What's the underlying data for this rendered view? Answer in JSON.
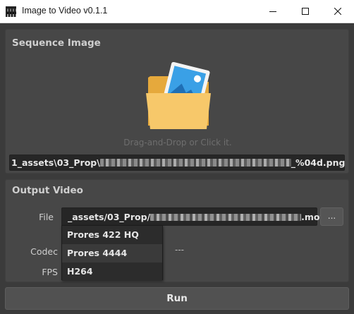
{
  "window": {
    "title": "Image to Video v0.1.1",
    "controls": [
      "minimize-icon",
      "maximize-icon",
      "close-icon"
    ]
  },
  "sequence_image": {
    "title": "Sequence Image",
    "drop_hint": "Drag-and-Drop or Click it.",
    "drop_icon": "folder-image-icon",
    "path_prefix": "1_assets\\03_Prop\\",
    "path_suffix": "_%04d.png"
  },
  "output_video": {
    "title": "Output Video",
    "file_label": "File",
    "file_prefix": "_assets/03_Prop/",
    "file_suffix": ".mov",
    "browse_label": "...",
    "codec_label": "Codec",
    "codec_value": "---",
    "fps_label": "FPS"
  },
  "codec_dropdown": {
    "options": [
      "Prores 422 HQ",
      "Prores 4444",
      "H264"
    ],
    "highlighted": "Prores 4444"
  },
  "run_label": "Run",
  "colors": {
    "background": "#3b3b3b",
    "panel": "#474747",
    "field": "#262626",
    "folder": "#f6c86a",
    "photo_sky": "#39a1e8"
  }
}
